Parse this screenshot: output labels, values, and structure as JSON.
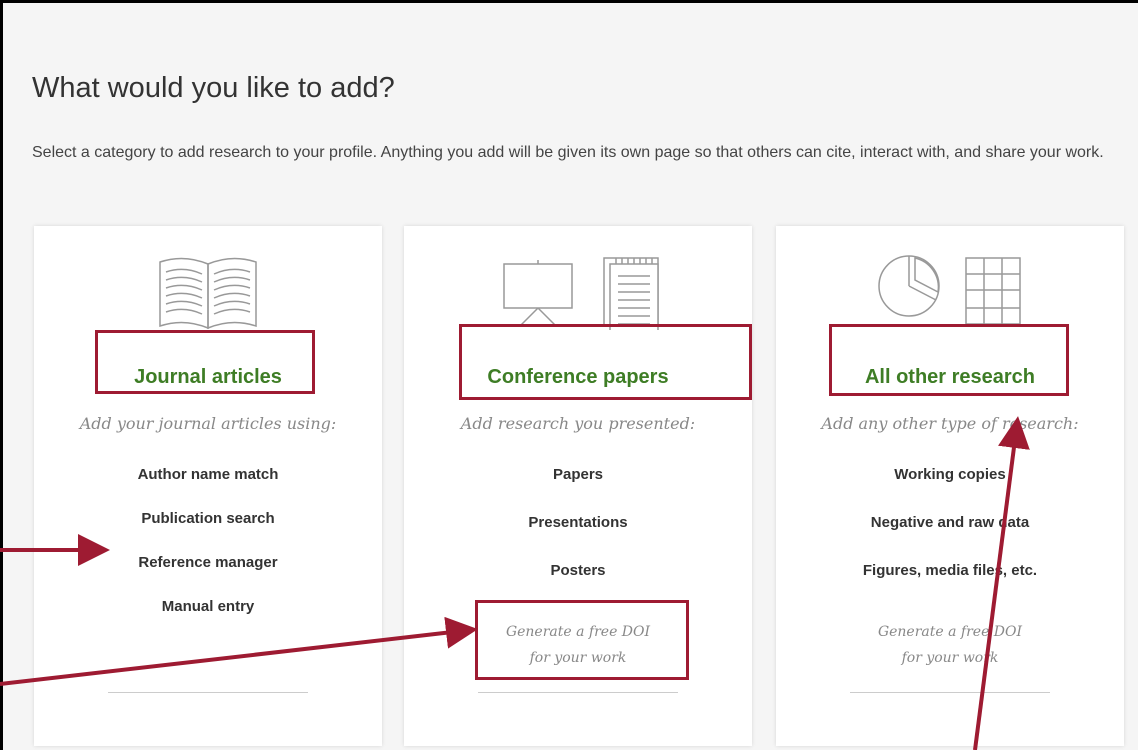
{
  "heading": "What would you like to add?",
  "intro": "Select a category to add research to your profile. Anything you add will be given its own page so that others can cite, interact with, and share your work.",
  "cards": [
    {
      "title": "Journal articles",
      "subtitle": "Add your journal articles using:",
      "options": [
        "Author name match",
        "Publication search",
        "Reference manager",
        "Manual entry"
      ],
      "icons": [
        "open-book-icon"
      ]
    },
    {
      "title": "Conference papers",
      "subtitle": "Add research you presented:",
      "options": [
        "Papers",
        "Presentations",
        "Posters"
      ],
      "doi": [
        "Generate a free DOI",
        "for your work"
      ],
      "icons": [
        "presentation-easel-icon",
        "notepad-icon"
      ]
    },
    {
      "title": "All other research",
      "subtitle": "Add any other type of research:",
      "options": [
        "Working copies",
        "Negative and raw data",
        "Figures, media files, etc."
      ],
      "doi": [
        "Generate a free DOI",
        "for your work"
      ],
      "icons": [
        "pie-chart-icon",
        "data-table-icon"
      ]
    }
  ],
  "colors": {
    "title_green": "#3e7d25",
    "annotation_red": "#9e1b32",
    "background": "#f5f5f5"
  }
}
